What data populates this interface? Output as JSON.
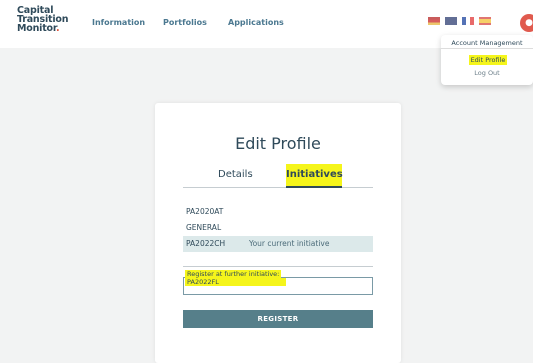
{
  "header": {
    "logo_line1": "Capital",
    "logo_line2": "Transition",
    "logo_line3": "Monitor",
    "logo_dot": ".",
    "nav": [
      "Information",
      "Portfolios",
      "Applications"
    ],
    "languages": [
      "de-flag-icon",
      "gb-flag-icon",
      "fr-flag-icon",
      "es-flag-icon"
    ],
    "avatar_icon": "user-avatar"
  },
  "account_menu": {
    "title": "Account Management",
    "edit_profile": "Edit Profile",
    "log_out": "Log Out"
  },
  "profile": {
    "title": "Edit Profile",
    "tabs": [
      "Details",
      "Initiatives"
    ],
    "active_tab": "Initiatives",
    "initiatives": [
      {
        "name": "PA2020AT",
        "note": ""
      },
      {
        "name": "GENERAL",
        "note": ""
      },
      {
        "name": "PA2022CH",
        "note": "Your current initiative"
      }
    ],
    "register_label": "Register at further initiative:",
    "register_value": "PA2022FL",
    "register_button": "REGISTER"
  },
  "colors": {
    "highlight": "#f5f51b",
    "primary": "#2f4a5a",
    "button": "#567f8a",
    "current_row": "#dce9ea"
  }
}
